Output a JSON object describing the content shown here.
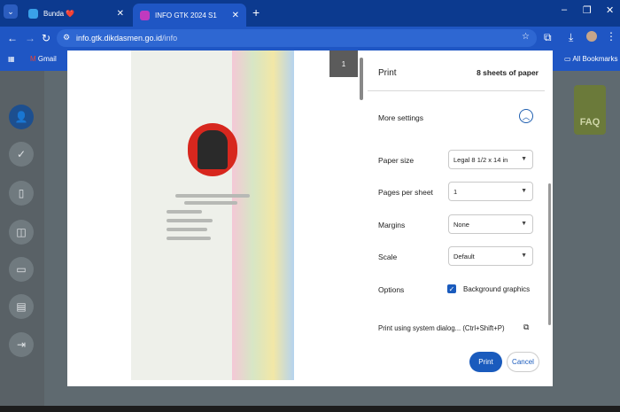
{
  "browser": {
    "tabs": [
      {
        "label": "Bunda ❤️",
        "active": false
      },
      {
        "label": "INFO GTK 2024 S1",
        "active": true
      }
    ],
    "new_tab": "+",
    "url_host": "info.gtk.dikdasmen.go.id",
    "url_path": "/info",
    "bookmarks": [
      "Gmail"
    ],
    "all_bookmarks": "All Bookmarks"
  },
  "print": {
    "title": "Print",
    "sheets": "8 sheets of paper",
    "page_number": "1",
    "more_settings": "More settings",
    "rows": [
      {
        "label": "Paper size",
        "value": "Legal 8 1/2 x 14 in"
      },
      {
        "label": "Pages per sheet",
        "value": "1"
      },
      {
        "label": "Margins",
        "value": "None"
      },
      {
        "label": "Scale",
        "value": "Default"
      }
    ],
    "options_label": "Options",
    "background_graphics": "Background graphics",
    "background_graphics_checked": true,
    "system_dialog": "Print using system dialog... (Ctrl+Shift+P)",
    "print_button": "Print",
    "cancel_button": "Cancel"
  },
  "page": {
    "faq": "FAQ"
  },
  "colors": {
    "accent": "#1a5bbd",
    "tabbar": "#0c3a8f",
    "toolbar": "#1f56c4"
  }
}
